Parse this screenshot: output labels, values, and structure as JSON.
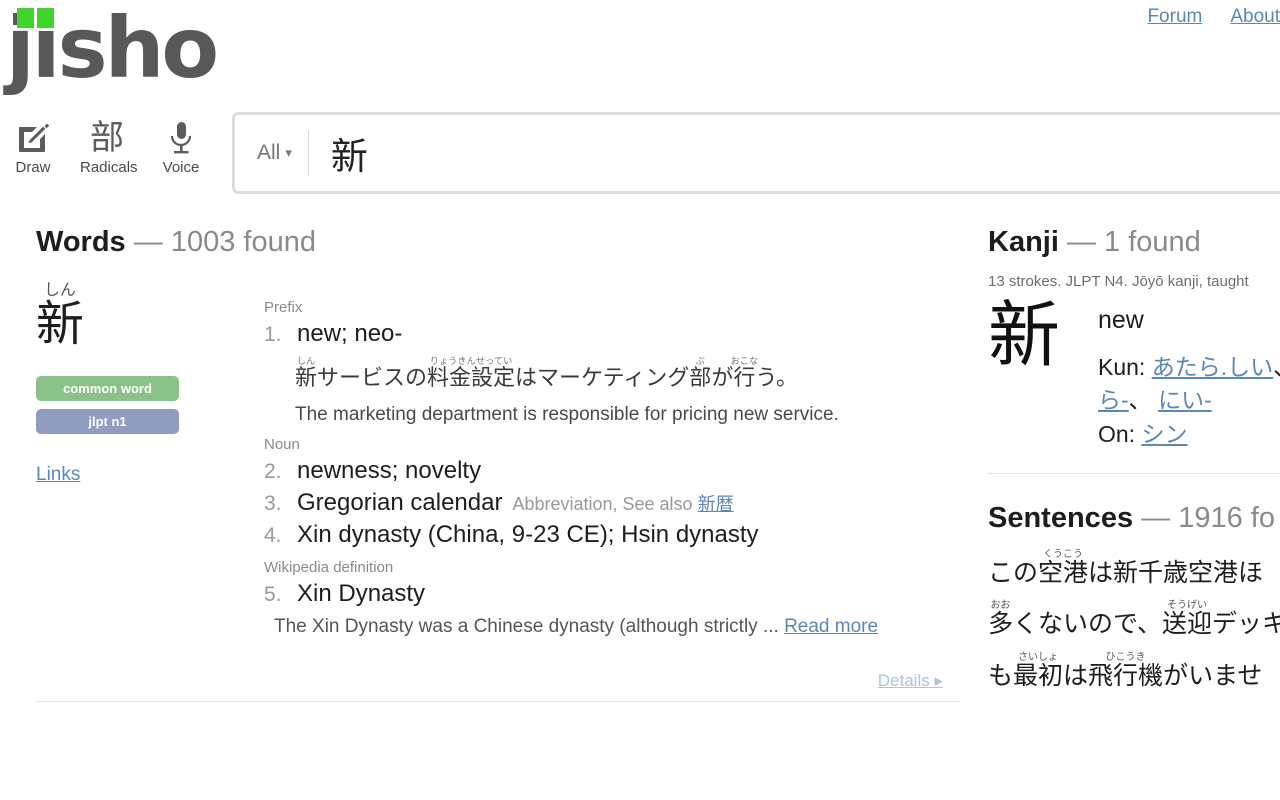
{
  "header": {
    "nav": [
      {
        "label": "Forum",
        "name": "nav-link-forum"
      },
      {
        "label": "About",
        "name": "nav-link-about"
      }
    ],
    "logo_text": "jisho",
    "logo_mark": "open-book-icon"
  },
  "tools": [
    {
      "label": "Draw",
      "icon": "draw-pencil-icon"
    },
    {
      "label": "Radicals",
      "icon": "radicals-kanji-icon",
      "glyph": "部"
    },
    {
      "label": "Voice",
      "icon": "microphone-icon"
    }
  ],
  "search": {
    "scope_label": "All",
    "scope_caret": "▾",
    "query": "新",
    "placeholder": ""
  },
  "words": {
    "heading_title": "Words",
    "heading_dash": "—",
    "heading_count": "1003 found",
    "entry": {
      "headword_kanji": "新",
      "headword_furigana": "しん",
      "tags": [
        {
          "label": "common word",
          "kind": "common"
        },
        {
          "label": "jlpt n1",
          "kind": "jlpt"
        }
      ],
      "links_label": "Links",
      "senses": [
        {
          "pos": "Prefix",
          "num": "1.",
          "definition": "new; neo-",
          "extra": "",
          "see_also": "",
          "example": {
            "japanese_plain": "新サービスの料金設定はマーケティング部が行う。",
            "segments": [
              {
                "base": "新",
                "ruby": "しん"
              },
              {
                "base": "サービスの",
                "ruby": ""
              },
              {
                "base": "料金設定",
                "ruby": "りょうきんせってい"
              },
              {
                "base": "はマーケティング",
                "ruby": ""
              },
              {
                "base": "部",
                "ruby": "ぶ"
              },
              {
                "base": "が",
                "ruby": ""
              },
              {
                "base": "行",
                "ruby": "おこな"
              },
              {
                "base": "う。",
                "ruby": ""
              }
            ],
            "english": "The marketing department is responsible for pricing new service."
          }
        },
        {
          "pos": "Noun",
          "num": "2.",
          "definition": "newness; novelty",
          "extra": "",
          "see_also": ""
        },
        {
          "pos": "",
          "num": "3.",
          "definition": "Gregorian calendar",
          "extra": "Abbreviation, See also",
          "see_also": "新暦"
        },
        {
          "pos": "",
          "num": "4.",
          "definition": "Xin dynasty (China, 9-23 CE); Hsin dynasty",
          "extra": "",
          "see_also": ""
        }
      ],
      "wikipedia": {
        "pos": "Wikipedia definition",
        "num": "5.",
        "title": "Xin Dynasty",
        "body": "The Xin Dynasty was a Chinese dynasty (although strictly ...",
        "read_more": "Read more"
      },
      "details_label": "Details ▸"
    }
  },
  "kanji": {
    "heading_title": "Kanji",
    "heading_dash": "—",
    "heading_count": "1 found",
    "meta": "13 strokes. JLPT N4. Jōyō kanji, taught",
    "character": "新",
    "meaning": "new",
    "kun_label": "Kun:",
    "kun_readings": [
      "あたら.しい",
      "ら-",
      "にい-"
    ],
    "kun_separator": "、",
    "on_label": "On:",
    "on_readings": [
      "シン"
    ]
  },
  "sentences": {
    "heading_title": "Sentences",
    "heading_dash": "—",
    "heading_count": "1916 fo",
    "lines": [
      {
        "plain": "この空港は新千歳空港ほ",
        "segments": [
          {
            "base": "この",
            "ruby": ""
          },
          {
            "base": "空港",
            "ruby": "くうこう"
          },
          {
            "base": "は新千歳空港ほ",
            "ruby": ""
          }
        ]
      },
      {
        "plain": "多くないので、送迎デッキ",
        "segments": [
          {
            "base": "多",
            "ruby": "おお"
          },
          {
            "base": "くないので、",
            "ruby": ""
          },
          {
            "base": "送迎",
            "ruby": "そうげい"
          },
          {
            "base": "デッキ",
            "ruby": ""
          }
        ]
      },
      {
        "plain": "も最初は飛行機がいませ",
        "segments": [
          {
            "base": "も",
            "ruby": ""
          },
          {
            "base": "最初",
            "ruby": "さいしょ"
          },
          {
            "base": "は",
            "ruby": ""
          },
          {
            "base": "飛行機",
            "ruby": "ひこうき"
          },
          {
            "base": "がいませ",
            "ruby": ""
          }
        ]
      }
    ]
  },
  "colors": {
    "logo_green": "#3fd32b",
    "logo_grey": "#585858",
    "link_blue": "#5b87b5",
    "tag_common": "#8bc28a",
    "tag_jlpt": "#909cc0",
    "details_blue": "#a9c5de"
  }
}
